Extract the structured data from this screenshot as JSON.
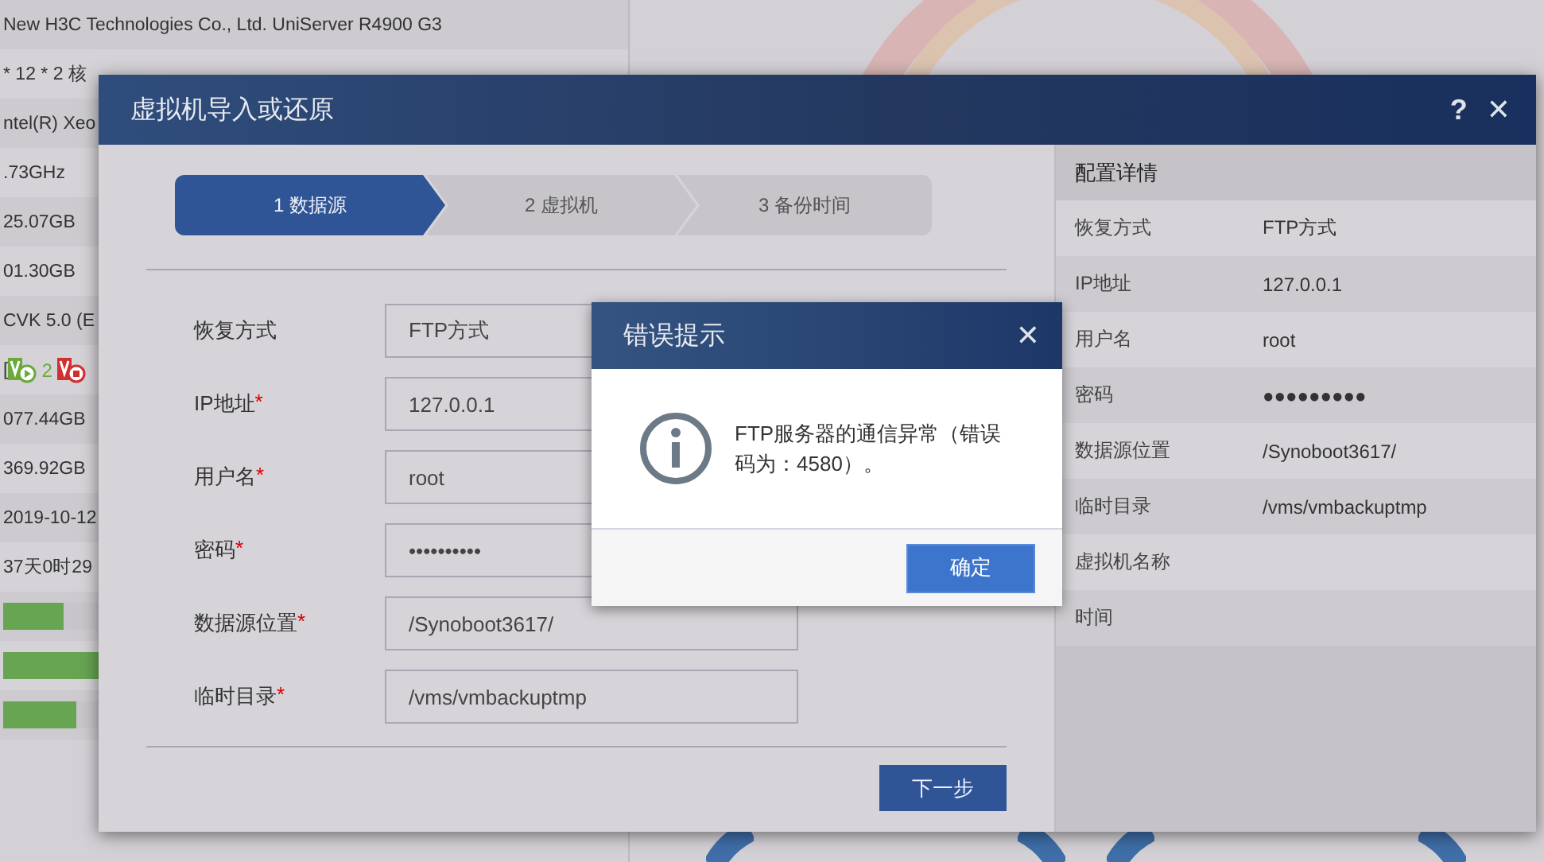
{
  "background": {
    "info_rows": [
      {
        "kind": "text",
        "text": "New H3C Technologies Co., Ltd. UniServer R4900 G3"
      },
      {
        "kind": "text",
        "text": "* 12 * 2 核"
      },
      {
        "kind": "text",
        "text": "ntel(R) Xeo"
      },
      {
        "kind": "text",
        "text": ".73GHz"
      },
      {
        "kind": "text",
        "text": "25.07GB"
      },
      {
        "kind": "text",
        "text": "01.30GB"
      },
      {
        "kind": "text",
        "text": "CVK 5.0 (E"
      },
      {
        "kind": "status",
        "text": "[",
        "items": [
          {
            "kind": "running",
            "count": "2"
          },
          {
            "kind": "stopped"
          }
        ]
      },
      {
        "kind": "text",
        "text": "077.44GB"
      },
      {
        "kind": "text",
        "text": "369.92GB"
      },
      {
        "kind": "text",
        "text": "2019-10-12"
      },
      {
        "kind": "text",
        "text": "37天0时29"
      },
      {
        "kind": "bar",
        "level": 0.38
      },
      {
        "kind": "bar",
        "level": 0.7
      },
      {
        "kind": "bar",
        "level": 0.46
      }
    ]
  },
  "dialog": {
    "title": "虚拟机导入或还原",
    "help": "?",
    "close": "✕",
    "steps": [
      {
        "label": "1 数据源",
        "selected": true
      },
      {
        "label": "2 虚拟机",
        "selected": false
      },
      {
        "label": "3 备份时间",
        "selected": false
      }
    ],
    "fields": [
      {
        "label": "恢复方式",
        "value": "FTP方式"
      },
      {
        "label": "IP地址",
        "required_mark": "*",
        "value": "127.0.0.1"
      },
      {
        "label": "用户名",
        "required_mark": "*",
        "value": "root"
      },
      {
        "label": "密码",
        "required_mark": "*",
        "value": "••••••••••"
      },
      {
        "label": "数据源位置",
        "required_mark": "*",
        "value": "/Synoboot3617/"
      },
      {
        "label": "临时目录",
        "required_mark": "*",
        "value": "/vms/vmbackuptmp"
      }
    ],
    "next_button": "下一步",
    "details": {
      "title": "配置详情",
      "rows": [
        {
          "label": "恢复方式",
          "value": "FTP方式"
        },
        {
          "label": "IP地址",
          "value": "127.0.0.1"
        },
        {
          "label": "用户名",
          "value": "root"
        },
        {
          "label": "密码",
          "value": "●●●●●●●●●"
        },
        {
          "label": "数据源位置",
          "value": "/Synoboot3617/"
        },
        {
          "label": "临时目录",
          "value": "/vms/vmbackuptmp"
        },
        {
          "label": "虚拟机名称"
        },
        {
          "label": "时间"
        }
      ]
    }
  },
  "error_dialog": {
    "title": "错误提示",
    "close": "✕",
    "message": "FTP服务器的通信异常（错误码为：4580）。",
    "ok_button": "确定"
  }
}
